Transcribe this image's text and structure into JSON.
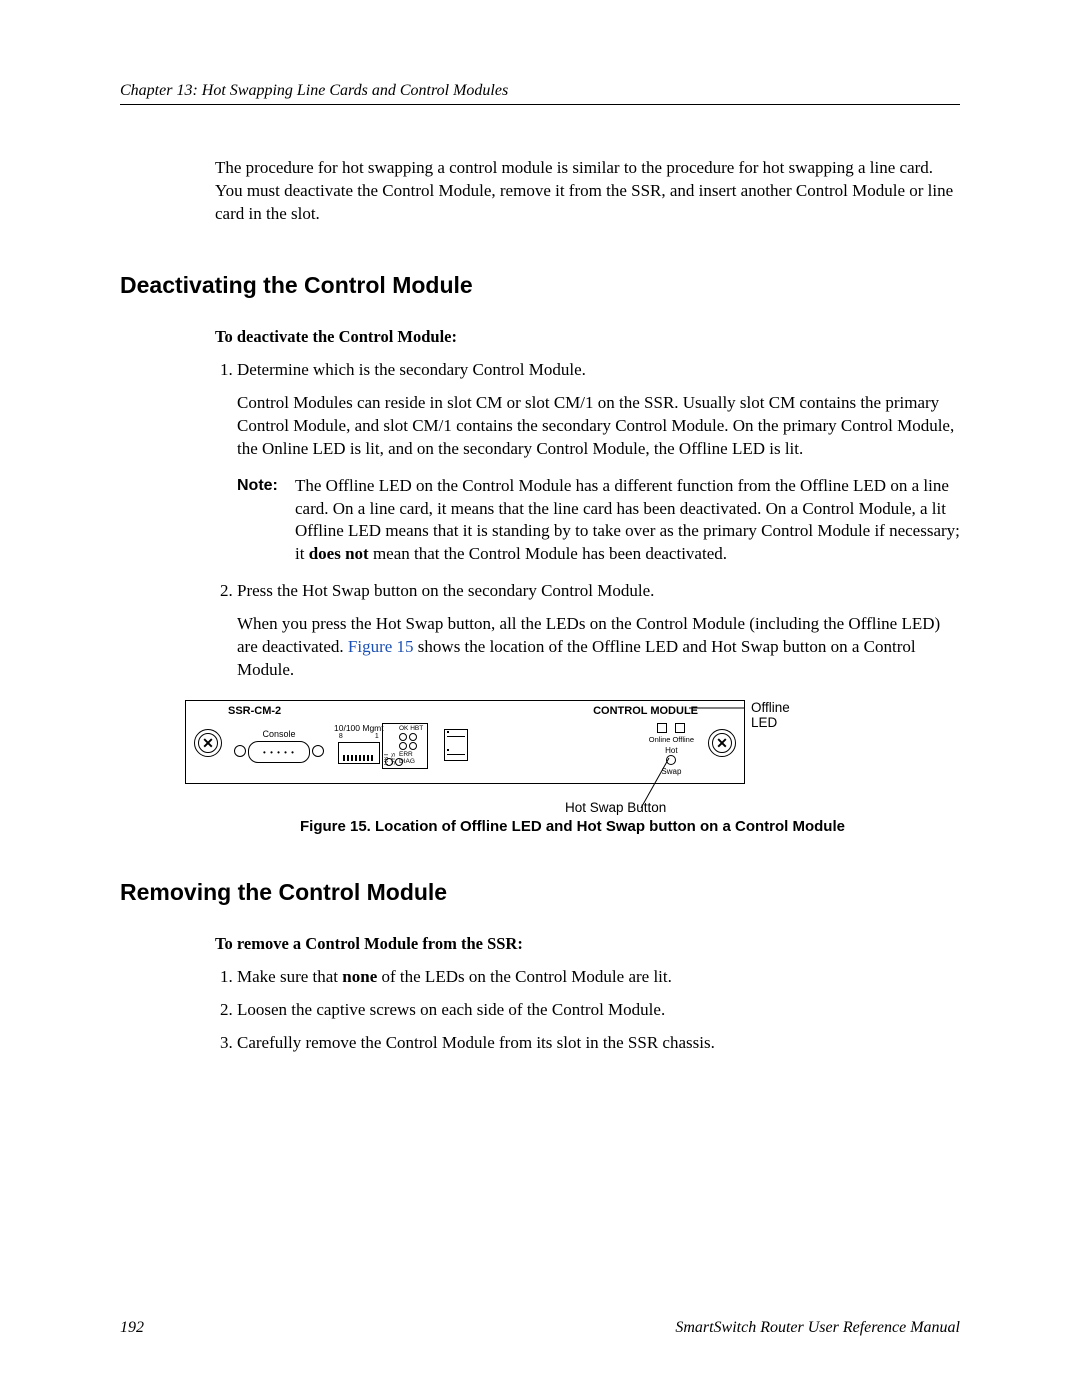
{
  "header": {
    "running": "Chapter 13: Hot Swapping Line Cards and Control Modules"
  },
  "intro": "The procedure for hot swapping a control module is similar to the procedure for hot swapping a line card. You must deactivate the Control Module, remove it from the SSR, and insert another Control Module or line card in the slot.",
  "section1": {
    "title": "Deactivating the Control Module",
    "subtitle": "To deactivate the Control Module:",
    "step1_a": "Determine which is the secondary Control Module.",
    "step1_b": "Control Modules can reside in slot CM or slot CM/1 on the SSR. Usually slot CM contains the primary Control Module, and slot CM/1 contains the secondary Control Module. On the primary Control Module, the Online LED is lit, and on the secondary Control Module, the Offline LED is lit.",
    "note_label": "Note:",
    "note_body_a": "The Offline LED on the Control Module has a different function from the Offline LED on a line card. On a line card, it means that the line card has been deactivated. On a Control Module, a lit Offline LED means that it is standing by to take over as the primary Control Module if necessary; it ",
    "note_strong": "does not",
    "note_body_b": " mean that the Control Module has been deactivated.",
    "step2_a": "Press the Hot Swap button on the secondary Control Module.",
    "step2_b_a": "When you press the Hot Swap button, all the LEDs on the Control Module (including the Offline LED) are deactivated. ",
    "step2_link": "Figure 15",
    "step2_b_b": " shows the location of the Offline LED and Hot Swap button on a Control Module."
  },
  "figure": {
    "model": "SSR-CM-2",
    "title": "CONTROL MODULE",
    "console": "Console",
    "mgmt": "10/100 Mgmt",
    "ok_hbt": "OK HBT",
    "err_diag": "ERR DIAG",
    "rst": "RST",
    "sys": "SYS",
    "online": "Online",
    "offline": "Offline",
    "hot": "Hot",
    "swap": "Swap",
    "callout_offline": "Offline LED",
    "callout_button": "Hot Swap Button",
    "caption": "Figure 15. Location of Offline LED and Hot Swap button on a Control Module"
  },
  "section2": {
    "title": "Removing the Control Module",
    "subtitle": "To remove a Control Module from the SSR:",
    "step1_a": "Make sure that ",
    "step1_strong": "none",
    "step1_b": " of the LEDs on the Control Module are lit.",
    "step2": "Loosen the captive screws on each side of the Control Module.",
    "step3": "Carefully remove the Control Module from its slot in the SSR chassis."
  },
  "footer": {
    "page": "192",
    "book": "SmartSwitch Router User Reference Manual"
  }
}
